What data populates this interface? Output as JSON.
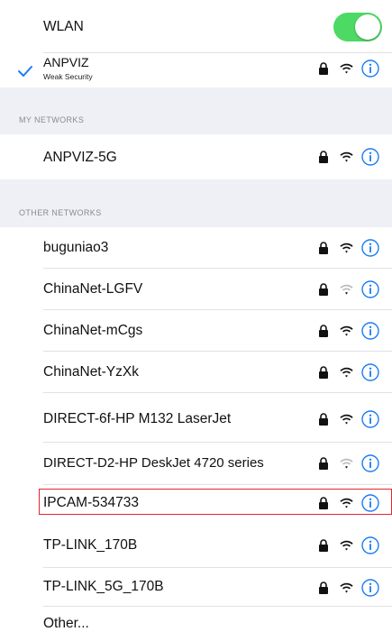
{
  "wlan": {
    "label": "WLAN",
    "enabled": true,
    "toggle_color": "#4cd964"
  },
  "connected": {
    "name": "ANPVIZ",
    "subtitle": "Weak Security",
    "icons": [
      "lock-icon",
      "wifi-icon",
      "info-icon"
    ]
  },
  "my_networks": {
    "title": "MY NETWORKS",
    "items": [
      {
        "name": "ANPVIZ-5G"
      }
    ]
  },
  "other_networks": {
    "title": "OTHER NETWORKS",
    "items": [
      {
        "name": "buguniao3"
      },
      {
        "name": "ChinaNet-LGFV"
      },
      {
        "name": "ChinaNet-mCgs"
      },
      {
        "name": "ChinaNet-YzXk"
      },
      {
        "name": "DIRECT-6f-HP M132 LaserJet"
      },
      {
        "name": "DIRECT-D2-HP DeskJet 4720 series"
      },
      {
        "name": "IPCAM-534733",
        "highlighted": true
      },
      {
        "name": "TP-LINK_170B"
      },
      {
        "name": "TP-LINK_5G_170B"
      }
    ],
    "other_label": "Other..."
  },
  "colors": {
    "accent": "#1a7cf5",
    "highlight_border": "#e0262f",
    "section_bg": "#eff0f5"
  }
}
